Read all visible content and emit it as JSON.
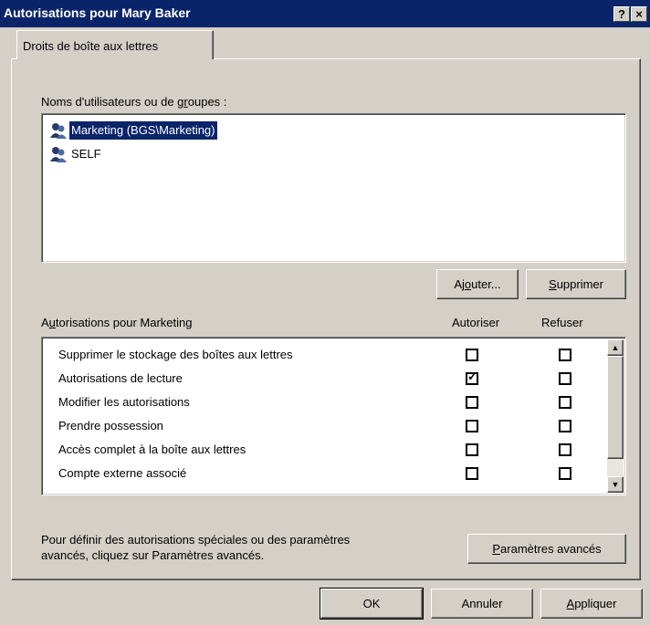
{
  "window": {
    "title": "Autorisations pour Mary Baker",
    "help_label": "?",
    "close_label": "×"
  },
  "tab": {
    "label": "Droits de boîte aux lettres"
  },
  "users_section": {
    "label": "Noms d'utilisateurs ou de groupes :",
    "items": [
      {
        "label": "Marketing (BGS\\Marketing)",
        "selected": true,
        "icon": "group-icon"
      },
      {
        "label": "SELF",
        "selected": false,
        "icon": "group-icon"
      }
    ],
    "add_button": "Ajouter...",
    "remove_button": "Supprimer"
  },
  "permissions_section": {
    "label": "Autorisations pour Marketing",
    "allow_header": "Autoriser",
    "deny_header": "Refuser",
    "rows": [
      {
        "label": "Supprimer le stockage des boîtes aux lettres",
        "allow": false,
        "deny": false
      },
      {
        "label": "Autorisations de lecture",
        "allow": true,
        "deny": false
      },
      {
        "label": "Modifier les autorisations",
        "allow": false,
        "deny": false
      },
      {
        "label": "Prendre possession",
        "allow": false,
        "deny": false
      },
      {
        "label": "Accès complet à la boîte aux lettres",
        "allow": false,
        "deny": false
      },
      {
        "label": "Compte externe associé",
        "allow": false,
        "deny": false
      }
    ]
  },
  "advanced": {
    "text_line1": "Pour définir des autorisations spéciales ou des paramètres",
    "text_line2": "avancés, cliquez sur Paramètres avancés.",
    "button": "Paramètres avancés"
  },
  "footer": {
    "ok": "OK",
    "cancel": "Annuler",
    "apply": "Appliquer"
  },
  "colors": {
    "titlebar": "#0a246a",
    "face": "#d4d0c8",
    "selection": "#0a246a"
  }
}
